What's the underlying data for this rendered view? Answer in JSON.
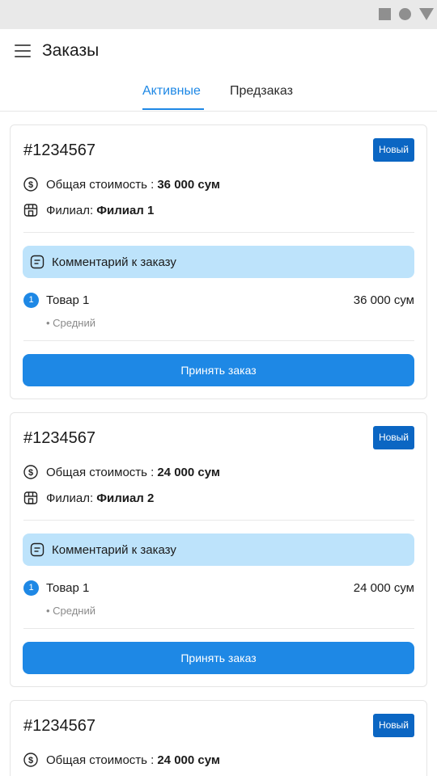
{
  "status_bar": {
    "icons": [
      "square-icon",
      "circle-icon",
      "triangle-icon"
    ]
  },
  "header": {
    "title": "Заказы",
    "menu_icon": "hamburger-icon"
  },
  "tabs": [
    {
      "label": "Активные",
      "active": true
    },
    {
      "label": "Предзаказ",
      "active": false
    }
  ],
  "colors": {
    "accent": "#1e88e5",
    "badge": "#0b66c3",
    "comment_bg": "#bde3fb"
  },
  "orders": [
    {
      "id": "#1234567",
      "status": "Новый",
      "total_label": "Общая стоимость :",
      "total": "36 000 сум",
      "branch_label": "Филиал:",
      "branch": "Филиал 1",
      "comment": "Комментарий к заказу",
      "items": [
        {
          "num": "1",
          "name": "Товар 1",
          "price": "36 000 сум",
          "modifier": "• Средний"
        }
      ],
      "button": "Принять заказ"
    },
    {
      "id": "#1234567",
      "status": "Новый",
      "total_label": "Общая стоимость :",
      "total": "24 000 сум",
      "branch_label": "Филиал:",
      "branch": "Филиал 2",
      "comment": "Комментарий к заказу",
      "items": [
        {
          "num": "1",
          "name": "Товар 1",
          "price": "24 000 сум",
          "modifier": "• Средний"
        }
      ],
      "button": "Принять заказ"
    },
    {
      "id": "#1234567",
      "status": "Новый",
      "total_label": "Общая стоимость :",
      "total": "24 000 сум"
    }
  ]
}
